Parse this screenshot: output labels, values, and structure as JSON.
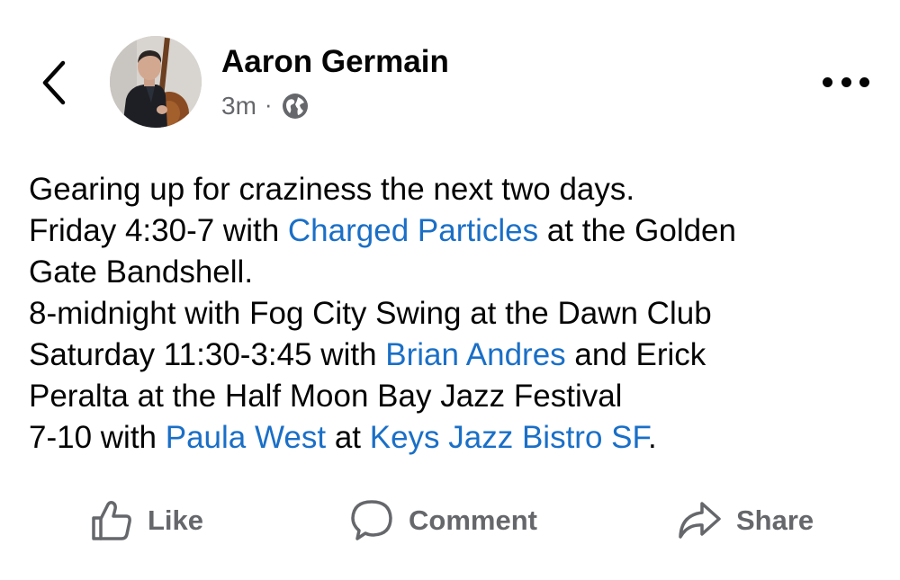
{
  "post": {
    "author": "Aaron Germain",
    "timestamp": "3m",
    "separator": "·",
    "privacy_icon": "globe-icon",
    "lines": [
      [
        {
          "text": "Gearing up for craziness the next two days."
        }
      ],
      [
        {
          "text": "Friday 4:30-7 with "
        },
        {
          "text": "Charged Particles",
          "link": true
        },
        {
          "text": " at the Golden"
        }
      ],
      [
        {
          "text": "Gate Bandshell."
        }
      ],
      [
        {
          "text": "8-midnight with Fog City Swing at the Dawn Club"
        }
      ],
      [
        {
          "text": "Saturday 11:30-3:45 with "
        },
        {
          "text": "Brian Andres",
          "link": true
        },
        {
          "text": " and Erick"
        }
      ],
      [
        {
          "text": "Peralta at the Half Moon Bay Jazz Festival"
        }
      ],
      [
        {
          "text": "7-10 with "
        },
        {
          "text": "Paula West",
          "link": true
        },
        {
          "text": " at "
        },
        {
          "text": "Keys Jazz Bistro SF",
          "link": true
        },
        {
          "text": "."
        }
      ]
    ]
  },
  "header": {
    "back_icon": "chevron-left-icon",
    "more_icon": "more-horizontal-icon"
  },
  "actions": {
    "like_label": "Like",
    "comment_label": "Comment",
    "share_label": "Share"
  },
  "colors": {
    "text": "#050505",
    "secondary": "#65676b",
    "link": "#1a6fc7",
    "background": "#ffffff"
  }
}
